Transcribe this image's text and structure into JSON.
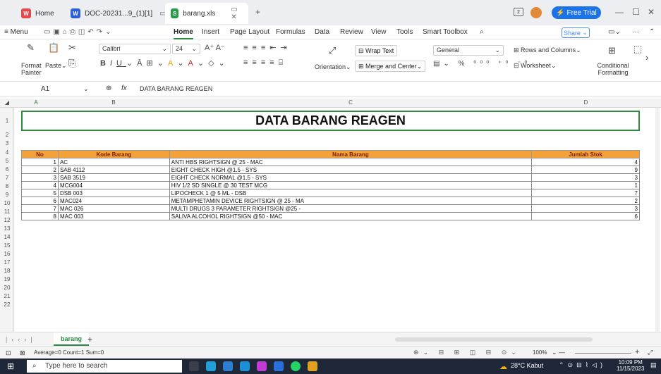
{
  "titlebar": {
    "tabs": [
      {
        "label": "Home"
      },
      {
        "label": "DOC-20231...9_(1)[1]"
      },
      {
        "label": "barang.xls"
      }
    ],
    "free_trial": "Free Trial"
  },
  "menu": {
    "menu_label": "Menu",
    "items": [
      "Home",
      "Insert",
      "Page Layout",
      "Formulas",
      "Data",
      "Review",
      "View",
      "Tools",
      "Smart Toolbox"
    ],
    "share": "Share"
  },
  "ribbon": {
    "format_painter": "Format Painter",
    "paste": "Paste",
    "font_name": "Calibri",
    "font_size": "24",
    "wrap_text": "Wrap Text",
    "orientation": "Orientation",
    "merge_center": "Merge and Center",
    "number_format": "General",
    "rows_columns": "Rows and Columns",
    "worksheet": "Worksheet",
    "conditional_formatting": "Conditional Formatting"
  },
  "formula": {
    "cell_ref": "A1",
    "fx": "fx",
    "content": "DATA BARANG REAGEN"
  },
  "columns": [
    "A",
    "B",
    "C",
    "D"
  ],
  "rows": [
    "1",
    "2",
    "3",
    "4",
    "5",
    "6",
    "7",
    "8",
    "9",
    "10",
    "11",
    "12",
    "13",
    "14",
    "15",
    "16",
    "17",
    "18",
    "19",
    "20",
    "21",
    "22"
  ],
  "sheet": {
    "title": "DATA BARANG REAGEN",
    "headers": [
      "No",
      "Kode Barang",
      "Nama Barang",
      "Jumlah Stok"
    ],
    "data": [
      [
        "1",
        "AC",
        "ANTI HBS RIGHTSIGN @ 25 - MAC",
        "4"
      ],
      [
        "2",
        "SAB 4112",
        "EIGHT CHECK HIGH @1.5 - SYS",
        "9"
      ],
      [
        "3",
        "SAB 3519",
        "EIGHT CHECK NORMAL @1.5 - SYS",
        "3"
      ],
      [
        "4",
        "MCG004",
        "HIV 1/2 SD SINGLE @ 30 TEST MCG",
        "1"
      ],
      [
        "5",
        "DSB 003",
        "LIPOCHECK 1 @ 5 ML - DSB",
        "7"
      ],
      [
        "6",
        "MAC024",
        "METAMPHETAMIN DEVICE RIGHTSIGN @ 25 - MA",
        "2"
      ],
      [
        "7",
        "MAC 026",
        "MULTI DRUGS 3 PARAMETER RIGHTSIGN @25 -",
        "3"
      ],
      [
        "8",
        "MAC 003",
        "SALIVA ALCOHOL RIGHTSIGN @50 - MAC",
        "6"
      ]
    ]
  },
  "sheet_tabs": {
    "active": "barang"
  },
  "status": {
    "summary": "Average=0  Count=1  Sum=0",
    "zoom": "100%"
  },
  "taskbar": {
    "search_placeholder": "Type here to search",
    "weather": "28°C  Kabut",
    "time": "10:09 PM",
    "date": "11/15/2023"
  }
}
